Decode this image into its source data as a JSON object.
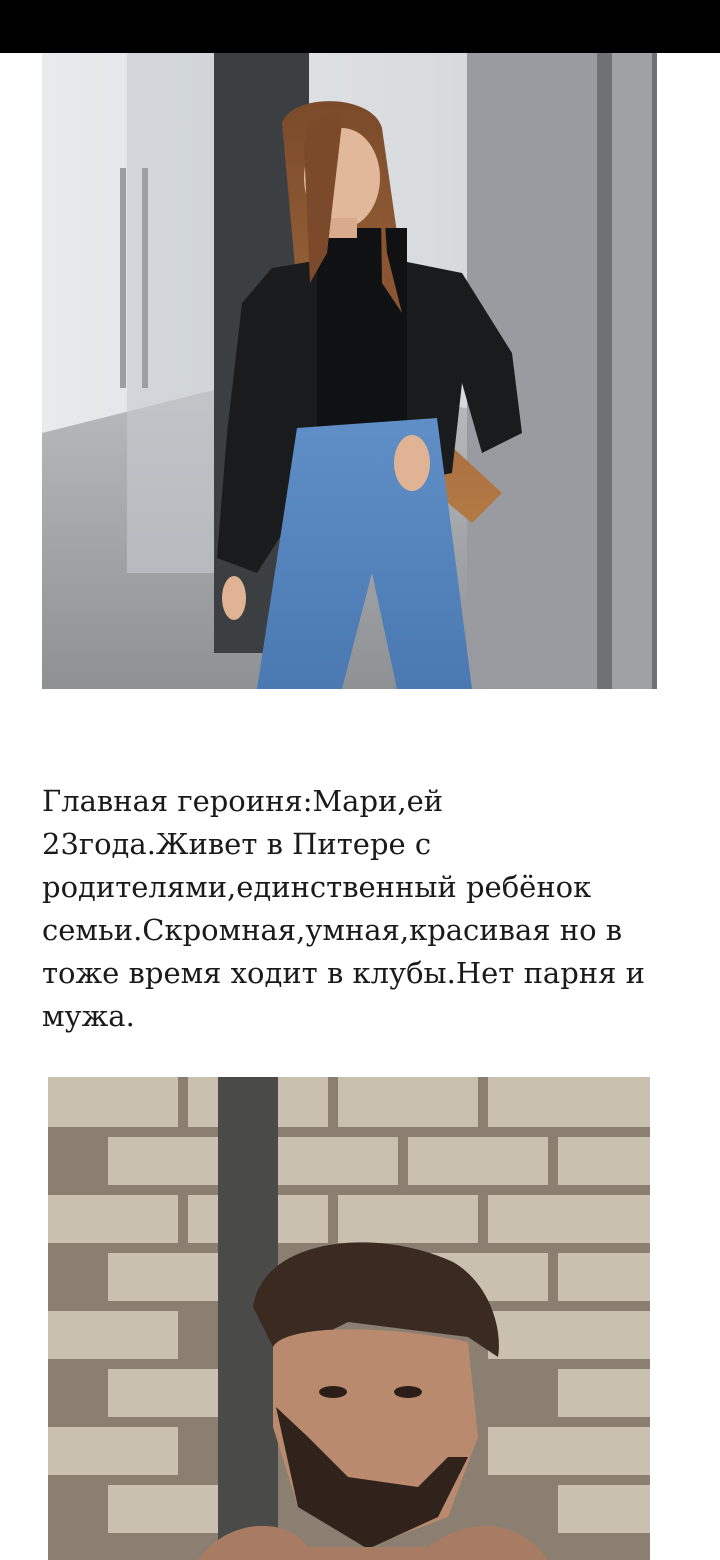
{
  "story": {
    "heroine_description": "Главная героиня:Мари,ей\n23года.Живет в Питере с\nродителями,единственный ребёнок\nсемьи.Скромная,умная,красивая но в\nтоже время ходит в клубы.Нет парня и\nмужа."
  },
  "colors": {
    "status_bar": "#000000",
    "background": "#ffffff",
    "text": "#1a1a1a"
  }
}
